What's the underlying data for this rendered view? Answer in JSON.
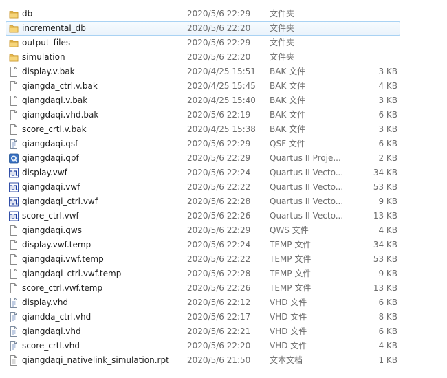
{
  "files": [
    {
      "name": "db",
      "date": "2020/5/6 22:29",
      "type": "文件夹",
      "size": "",
      "icon": "folder-icon"
    },
    {
      "name": "incremental_db",
      "date": "2020/5/6 22:20",
      "type": "文件夹",
      "size": "",
      "icon": "folder-icon",
      "selected": true
    },
    {
      "name": "output_files",
      "date": "2020/5/6 22:29",
      "type": "文件夹",
      "size": "",
      "icon": "folder-icon"
    },
    {
      "name": "simulation",
      "date": "2020/5/6 22:20",
      "type": "文件夹",
      "size": "",
      "icon": "folder-icon"
    },
    {
      "name": "display.v.bak",
      "date": "2020/4/25 15:51",
      "type": "BAK 文件",
      "size": "3 KB",
      "icon": "file-icon"
    },
    {
      "name": "qiangda_ctrl.v.bak",
      "date": "2020/4/25 15:45",
      "type": "BAK 文件",
      "size": "4 KB",
      "icon": "file-icon"
    },
    {
      "name": "qiangdaqi.v.bak",
      "date": "2020/4/25 15:40",
      "type": "BAK 文件",
      "size": "3 KB",
      "icon": "file-icon"
    },
    {
      "name": "qiangdaqi.vhd.bak",
      "date": "2020/5/6 22:19",
      "type": "BAK 文件",
      "size": "6 KB",
      "icon": "file-icon"
    },
    {
      "name": "score_crtl.v.bak",
      "date": "2020/4/25 15:38",
      "type": "BAK 文件",
      "size": "3 KB",
      "icon": "file-icon"
    },
    {
      "name": "qiangdaqi.qsf",
      "date": "2020/5/6 22:29",
      "type": "QSF 文件",
      "size": "6 KB",
      "icon": "text-file-icon"
    },
    {
      "name": "qiangdaqi.qpf",
      "date": "2020/5/6 22:29",
      "type": "Quartus II Proje...",
      "size": "2 KB",
      "icon": "quartus-project-icon"
    },
    {
      "name": "display.vwf",
      "date": "2020/5/6 22:24",
      "type": "Quartus II Vecto...",
      "size": "34 KB",
      "icon": "waveform-icon"
    },
    {
      "name": "qiangdaqi.vwf",
      "date": "2020/5/6 22:22",
      "type": "Quartus II Vecto...",
      "size": "53 KB",
      "icon": "waveform-icon"
    },
    {
      "name": "qiangdaqi_ctrl.vwf",
      "date": "2020/5/6 22:28",
      "type": "Quartus II Vecto...",
      "size": "9 KB",
      "icon": "waveform-icon"
    },
    {
      "name": "score_ctrl.vwf",
      "date": "2020/5/6 22:26",
      "type": "Quartus II Vecto...",
      "size": "13 KB",
      "icon": "waveform-icon"
    },
    {
      "name": "qiangdaqi.qws",
      "date": "2020/5/6 22:29",
      "type": "QWS 文件",
      "size": "4 KB",
      "icon": "file-icon"
    },
    {
      "name": "display.vwf.temp",
      "date": "2020/5/6 22:24",
      "type": "TEMP 文件",
      "size": "34 KB",
      "icon": "file-icon"
    },
    {
      "name": "qiangdaqi.vwf.temp",
      "date": "2020/5/6 22:22",
      "type": "TEMP 文件",
      "size": "53 KB",
      "icon": "file-icon"
    },
    {
      "name": "qiangdaqi_ctrl.vwf.temp",
      "date": "2020/5/6 22:28",
      "type": "TEMP 文件",
      "size": "9 KB",
      "icon": "file-icon"
    },
    {
      "name": "score_ctrl.vwf.temp",
      "date": "2020/5/6 22:26",
      "type": "TEMP 文件",
      "size": "13 KB",
      "icon": "file-icon"
    },
    {
      "name": "display.vhd",
      "date": "2020/5/6 22:12",
      "type": "VHD 文件",
      "size": "6 KB",
      "icon": "text-file-icon"
    },
    {
      "name": "qiandda_ctrl.vhd",
      "date": "2020/5/6 22:17",
      "type": "VHD 文件",
      "size": "8 KB",
      "icon": "text-file-icon"
    },
    {
      "name": "qiangdaqi.vhd",
      "date": "2020/5/6 22:21",
      "type": "VHD 文件",
      "size": "6 KB",
      "icon": "text-file-icon"
    },
    {
      "name": "score_crtl.vhd",
      "date": "2020/5/6 22:20",
      "type": "VHD 文件",
      "size": "4 KB",
      "icon": "text-file-icon"
    },
    {
      "name": "qiangdaqi_nativelink_simulation.rpt",
      "date": "2020/5/6 21:50",
      "type": "文本文档",
      "size": "1 KB",
      "icon": "text-document-icon"
    }
  ]
}
